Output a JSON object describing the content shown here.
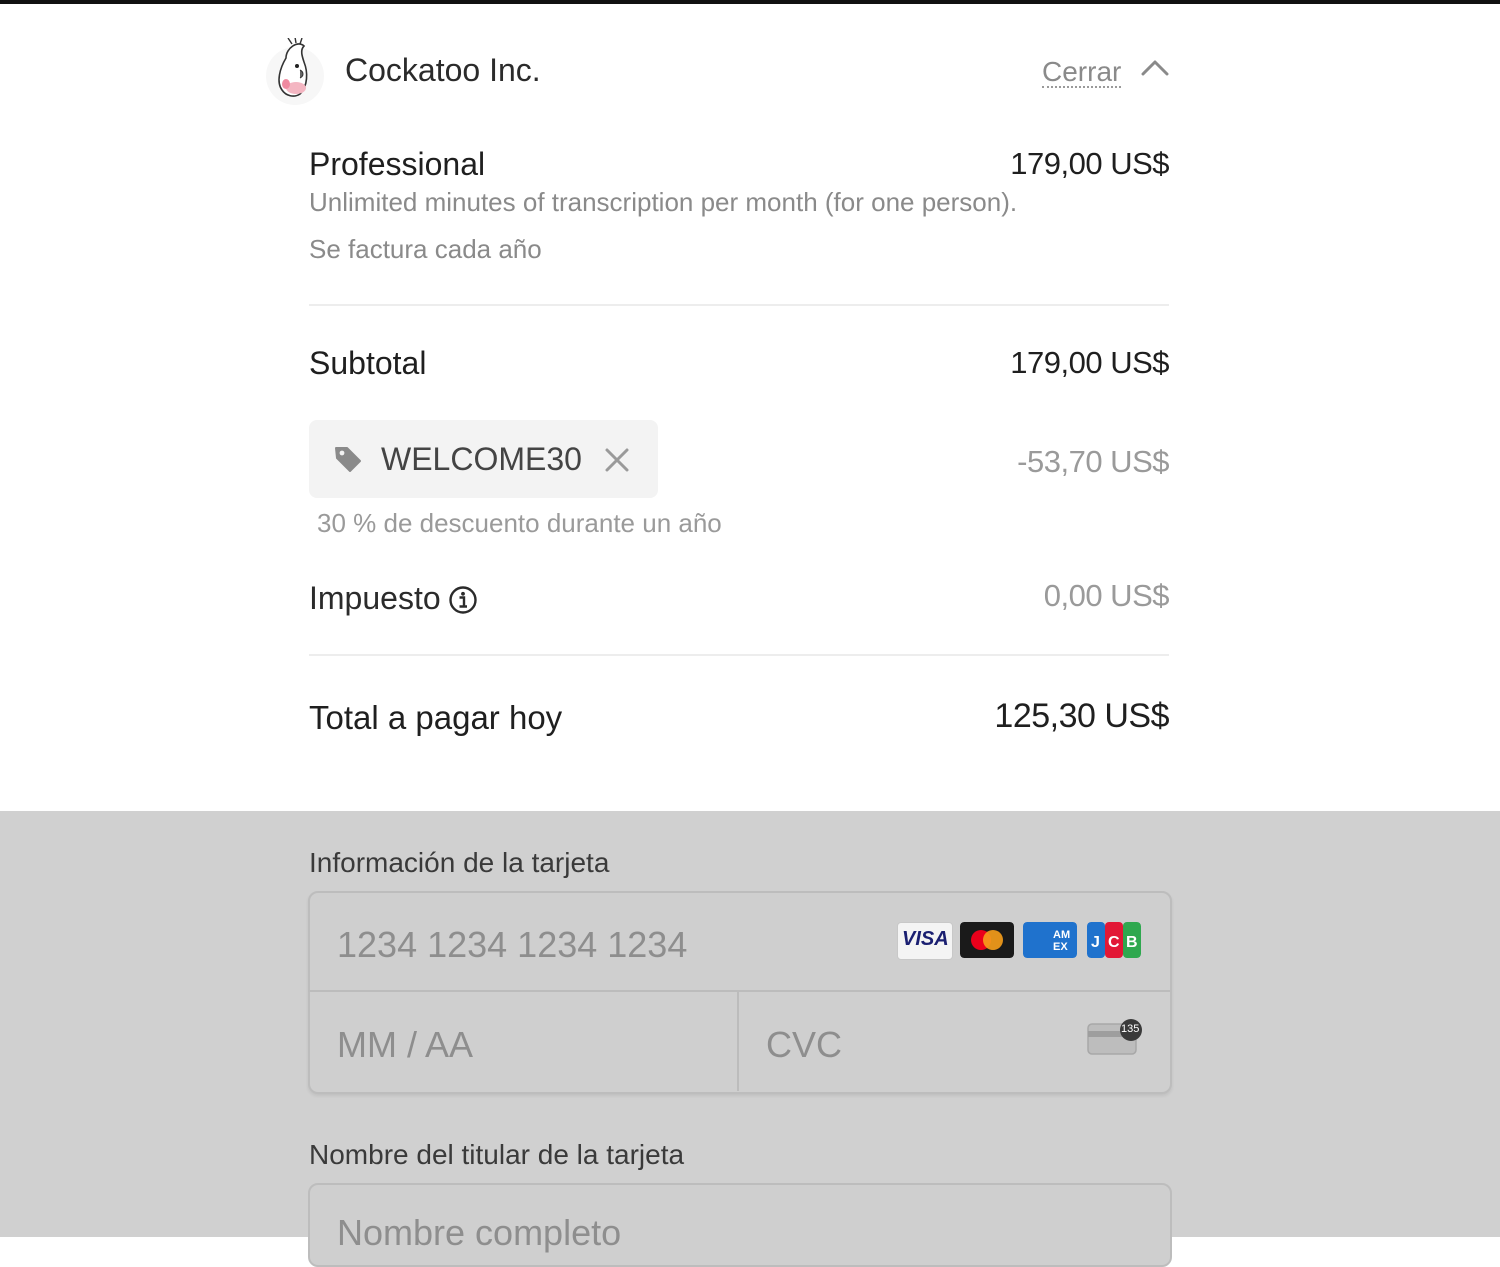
{
  "header": {
    "merchant_name": "Cockatoo Inc.",
    "close_label": "Cerrar"
  },
  "product": {
    "name": "Professional",
    "price": "179,00 US$",
    "description": "Unlimited minutes of transcription per month (for one person).",
    "billing": "Se factura cada año"
  },
  "summary": {
    "subtotal_label": "Subtotal",
    "subtotal_value": "179,00 US$",
    "promo_code": "WELCOME30",
    "discount_value": "-53,70 US$",
    "discount_description": "30 % de descuento durante un año",
    "tax_label": "Impuesto",
    "tax_value": "0,00 US$",
    "total_label": "Total a pagar hoy",
    "total_value": "125,30 US$"
  },
  "card": {
    "section_label": "Información de la tarjeta",
    "number_placeholder": "1234 1234 1234 1234",
    "expiry_placeholder": "MM / AA",
    "cvc_placeholder": "CVC",
    "brands": [
      "VISA",
      "Mastercard",
      "AMEX",
      "JCB"
    ],
    "cvc_hint": "135"
  },
  "holder": {
    "section_label": "Nombre del titular de la tarjeta",
    "placeholder": "Nombre completo"
  },
  "colors": {
    "overlay": "#d0d0d0",
    "visa_blue": "#1a1f71",
    "amex_blue": "#1f72cd",
    "mastercard_red": "#eb001b",
    "mastercard_orange": "#f79e1b"
  }
}
